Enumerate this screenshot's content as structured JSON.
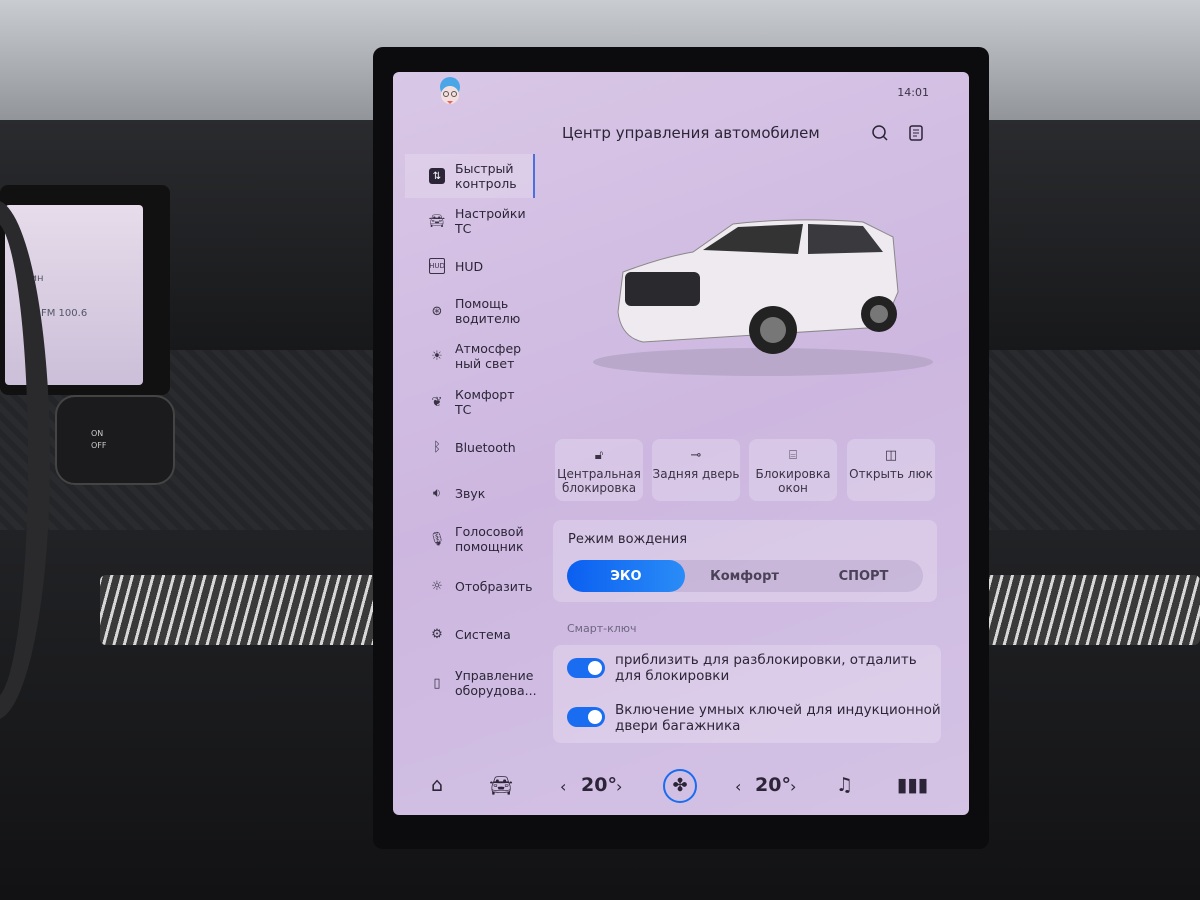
{
  "background": {
    "left_screen": {
      "line1": "мин",
      "line2": "FM 100.6"
    },
    "stalk_labels": [
      "ON",
      "OFF"
    ]
  },
  "status": {
    "time": "14:01"
  },
  "header": {
    "title": "Центр управления автомобилем",
    "icons": [
      "search-icon",
      "notes-icon"
    ]
  },
  "sidebar": {
    "items": [
      {
        "label": "Быстрый контроль",
        "icon": "sliders-icon",
        "active": true
      },
      {
        "label": "Настройки ТС",
        "icon": "car-icon"
      },
      {
        "label": "HUD",
        "icon": "hud-icon"
      },
      {
        "label": "Помощь водителю",
        "icon": "steering-wheel-icon"
      },
      {
        "label": "Атмосферный свет",
        "icon": "ambient-light-icon"
      },
      {
        "label": "Комфорт ТС",
        "icon": "leaf-icon"
      },
      {
        "label": "Bluetooth",
        "icon": "bluetooth-icon"
      },
      {
        "label": "Звук",
        "icon": "speaker-icon"
      },
      {
        "label": "Голосовой помощник",
        "icon": "microphone-icon"
      },
      {
        "label": "Отобразить",
        "icon": "brightness-icon"
      },
      {
        "label": "Система",
        "icon": "gear-icon"
      },
      {
        "label": "Управление оборудова...",
        "icon": "device-icon"
      }
    ]
  },
  "quick_actions": [
    {
      "label": "Центральная блокировка",
      "icon": "unlock-icon"
    },
    {
      "label": "Задняя дверь",
      "icon": "tailgate-icon"
    },
    {
      "label": "Блокировка окон",
      "icon": "window-lock-icon"
    },
    {
      "label": "Открыть люк",
      "icon": "sunroof-icon"
    }
  ],
  "drive_mode": {
    "title": "Режим вождения",
    "options": [
      "ЭКО",
      "Комфорт",
      "СПОРТ"
    ],
    "selected": "ЭКО"
  },
  "smart_key": {
    "title": "Смарт-ключ",
    "toggles": [
      {
        "label": "приблизить для разблокировки, отдалить для блокировки",
        "on": true
      },
      {
        "label": "Включение умных ключей для индукционной двери багажника",
        "on": true
      }
    ]
  },
  "dock": {
    "left_temp": "20°",
    "right_temp": "20°",
    "icons": [
      "home-icon",
      "car-icon",
      "fan-icon",
      "music-icon",
      "apps-icon"
    ]
  },
  "colors": {
    "accent": "#1a6cf0",
    "screen_bg": "#d2bfe3",
    "text": "#2c2537"
  }
}
